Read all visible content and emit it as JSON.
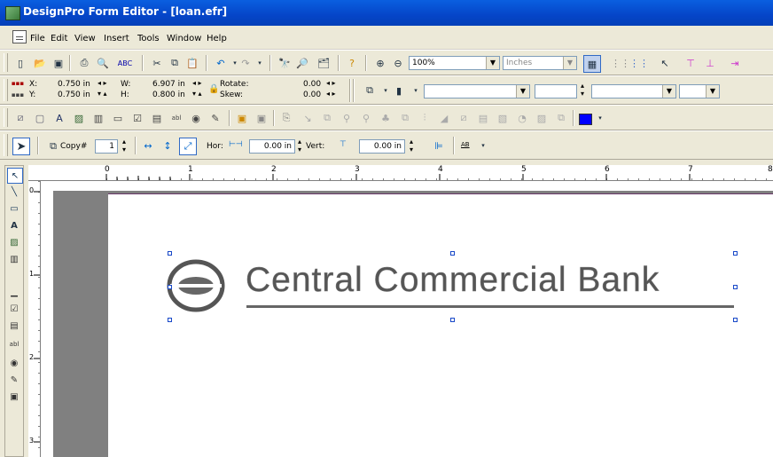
{
  "window": {
    "title": "DesignPro Form Editor - [loan.efr]"
  },
  "menu": [
    "File",
    "Edit",
    "View",
    "Insert",
    "Tools",
    "Window",
    "Help"
  ],
  "toolbar1": {
    "zoom": "100%",
    "units": "Inches"
  },
  "toolbar2": {
    "x_label": "X:",
    "x_value": "0.750 in",
    "y_label": "Y:",
    "y_value": "0.750 in",
    "w_label": "W:",
    "w_value": "6.907 in",
    "h_label": "H:",
    "h_value": "0.800 in",
    "rotate_label": "Rotate:",
    "rotate_value": "0.00",
    "skew_label": "Skew:",
    "skew_value": "0.00"
  },
  "toolbar4": {
    "copy_label": "Copy#",
    "copy_value": "1",
    "hor_label": "Hor:",
    "hor_value": "0.00 in",
    "vert_label": "Vert:",
    "vert_value": "0.00 in",
    "ab_label": "AB"
  },
  "colors": {
    "fill_swatch": "#0000ff"
  },
  "ruler": {
    "h_numbers": [
      "0",
      "1",
      "2",
      "3",
      "4",
      "5",
      "6",
      "7",
      "8"
    ],
    "v_numbers": [
      "0",
      "1",
      "2",
      "3"
    ]
  },
  "logo": {
    "text": "Central Commercial Bank"
  }
}
